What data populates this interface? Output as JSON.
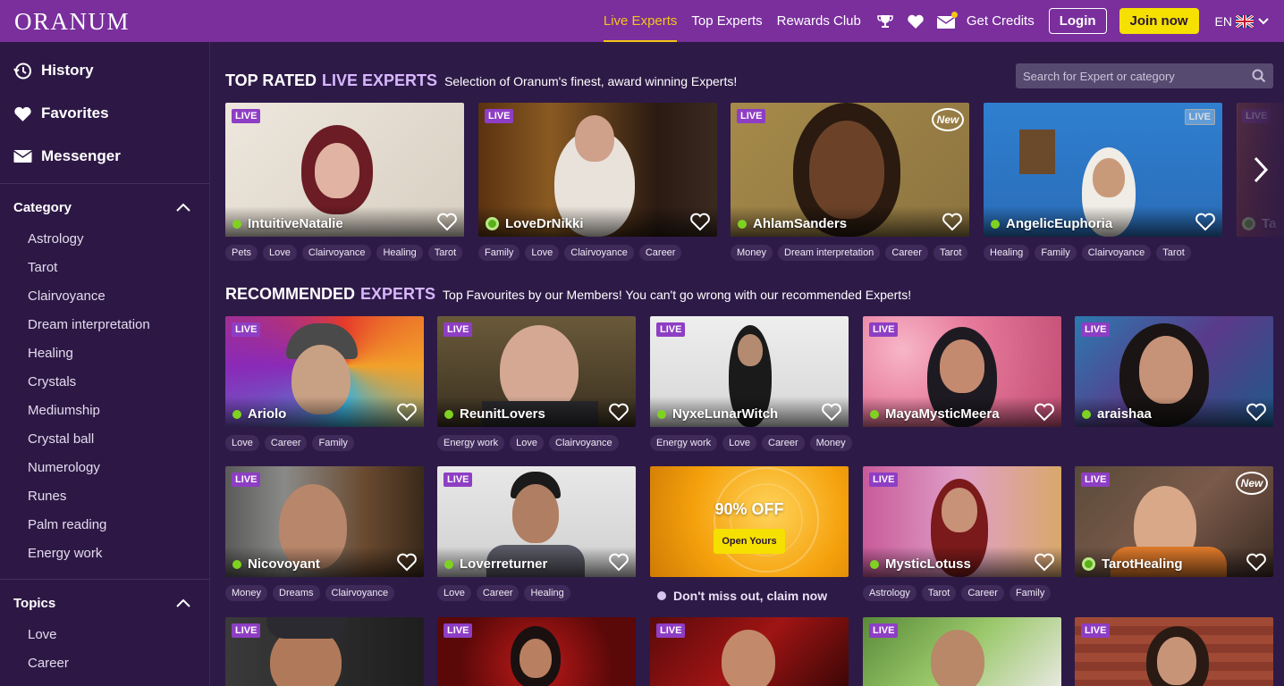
{
  "header": {
    "logo": "ORANUM",
    "nav": [
      "Live Experts",
      "Top Experts",
      "Rewards Club"
    ],
    "get_credits": "Get Credits",
    "login": "Login",
    "join": "Join now",
    "lang": "EN",
    "icons": [
      "trophy-icon",
      "heart-icon",
      "mail-icon"
    ]
  },
  "sidebar": {
    "main": [
      {
        "label": "History",
        "icon": "history-icon"
      },
      {
        "label": "Favorites",
        "icon": "heart-icon"
      },
      {
        "label": "Messenger",
        "icon": "envelope-icon"
      }
    ],
    "category_title": "Category",
    "categories": [
      "Astrology",
      "Tarot",
      "Clairvoyance",
      "Dream interpretation",
      "Healing",
      "Crystals",
      "Mediumship",
      "Crystal ball",
      "Numerology",
      "Runes",
      "Palm reading",
      "Energy work"
    ],
    "topics_title": "Topics",
    "topics": [
      "Love",
      "Career"
    ]
  },
  "top_rated": {
    "title_a": "TOP RATED",
    "title_b": "LIVE EXPERTS",
    "subtitle": "Selection of Oranum's finest, award winning Experts!",
    "search_placeholder": "Search for Expert or category",
    "badge_live": "LIVE",
    "badge_new": "New",
    "partial_name": "Ta",
    "experts": [
      {
        "name": "IntuitiveNatalie",
        "badge": "LIVE",
        "tags": [
          "Pets",
          "Love",
          "Clairvoyance",
          "Healing",
          "Tarot"
        ]
      },
      {
        "name": "LoveDrNikki",
        "badge": "LIVE",
        "tags": [
          "Family",
          "Love",
          "Clairvoyance",
          "Career"
        ]
      },
      {
        "name": "AhlamSanders",
        "badge": "LIVE",
        "new": "New",
        "tags": [
          "Money",
          "Dream interpretation",
          "Career",
          "Tarot"
        ]
      },
      {
        "name": "AngelicEuphoria",
        "badge": "LIVE",
        "tags": [
          "Healing",
          "Family",
          "Clairvoyance",
          "Tarot"
        ]
      }
    ]
  },
  "recommended": {
    "title_a": "RECOMMENDED",
    "title_b": "EXPERTS",
    "subtitle": "Top Favourites by our Members! You can't go wrong with our recommended Experts!",
    "row1": [
      {
        "name": "Ariolo",
        "badge": "LIVE",
        "tags": [
          "Love",
          "Career",
          "Family"
        ]
      },
      {
        "name": "ReunitLovers",
        "badge": "LIVE",
        "tags": [
          "Energy work",
          "Love",
          "Clairvoyance"
        ]
      },
      {
        "name": "NyxeLunarWitch",
        "badge": "LIVE",
        "tags": [
          "Energy work",
          "Love",
          "Career",
          "Money"
        ]
      },
      {
        "name": "MayaMysticMeera",
        "badge": "LIVE",
        "tags": []
      },
      {
        "name": "araishaa",
        "badge": "LIVE",
        "tags": []
      }
    ],
    "row2": [
      {
        "name": "Nicovoyant",
        "badge": "LIVE",
        "tags": [
          "Money",
          "Dreams",
          "Clairvoyance"
        ]
      },
      {
        "name": "Loverreturner",
        "badge": "LIVE",
        "tags": [
          "Love",
          "Career",
          "Healing"
        ]
      },
      {
        "name": "MysticLotuss",
        "badge": "LIVE",
        "tags": [
          "Astrology",
          "Tarot",
          "Career",
          "Family"
        ]
      },
      {
        "name": "TarotHealing",
        "badge": "LIVE",
        "new": "New",
        "tags": []
      }
    ],
    "promo": {
      "title": "90% OFF",
      "button": "Open Yours",
      "caption": "Don't miss out, claim now"
    },
    "row3_badges": [
      "LIVE",
      "LIVE",
      "LIVE",
      "LIVE",
      "LIVE"
    ]
  },
  "colors": {
    "header": "#7a2f9d",
    "background": "#2e1a47",
    "accent_yellow": "#f5e000",
    "live_badge": "#8e3ec4",
    "online": "#7ed321"
  }
}
